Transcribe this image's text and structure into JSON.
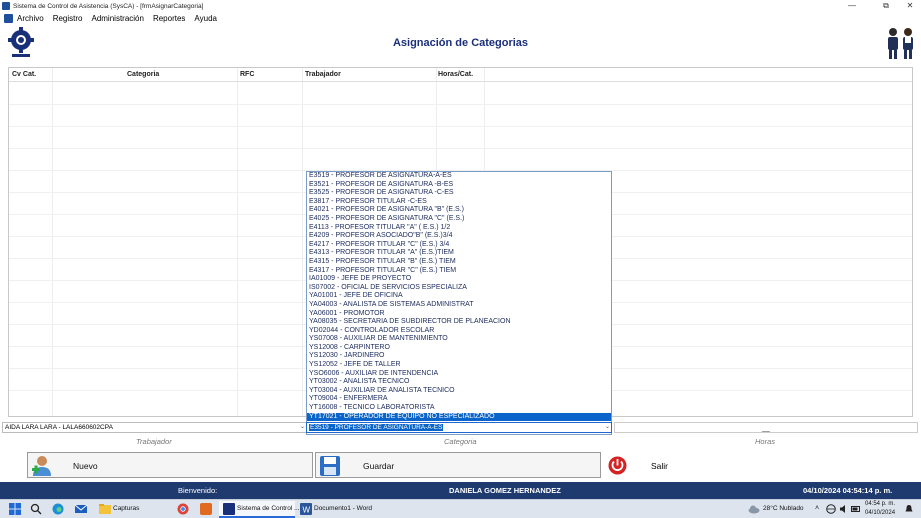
{
  "window": {
    "title": "Sistema de Control de Asistencia (SysCA) - [frmAsignarCategoria]",
    "controls": [
      "—",
      "⧉",
      "✕"
    ]
  },
  "menu": [
    "Archivo",
    "Registro",
    "Administración",
    "Reportes",
    "Ayuda"
  ],
  "page": {
    "title": "Asignación de Categorias"
  },
  "grid": {
    "columns": [
      "Cv Cat.",
      "Categoria",
      "RFC",
      "Trabajador",
      "Horas/Cat."
    ]
  },
  "listbox": {
    "items": [
      "E3519 - PROFESOR DE ASIGNATURA-A-ES",
      "E3521 - PROFESOR DE ASIGNATURA -B-ES",
      "E3525 - PROFESOR DE ASIGNATURA -C-ES",
      "E3817 - PROFESOR TITULAR -C-ES",
      "E4021 - PROFESOR DE ASIGNATURA \"B\" (E.S.)",
      "E4025 - PROFESOR DE ASIGNATURA \"C\" (E.S.)",
      "E4113 - PROFESOR TITULAR  \"A\" ( E.S.) 1/2",
      "E4209 - PROFESOR ASOCIADO\"B\" (E.S.)3/4",
      "E4217 - PROFESOR TITULAR \"C\" (E.S.) 3/4",
      "E4313 - PROFESOR TITULAR  \"A\" (E.S.)TIEM",
      "E4315 - PROFESOR TITULAR \"B\" (E.S.) TIEM",
      "E4317 - PROFESOR TITULAR \"C\" (E.S.) TIEM",
      "IA01009 - JEFE DE PROYECTO",
      "IS07002 - OFICIAL DE SERVICIOS ESPECIALIZA",
      "YA01001 - JEFE DE OFICINA",
      "YA04003 - ANALISTA DE SISTEMAS ADMINISTRAT",
      "YA06001 - PROMOTOR",
      "YA08035 - SECRETARIA DE SUBDIRECTOR DE PLANEACION",
      "YD02044 - CONTROLADOR ESCOLAR",
      "YS07008 - AUXILIAR DE MANTENIMIENTO",
      "YS12008 - CARPINTERO",
      "YS12030 - JARDINERO",
      "YS12052 - JEFE DE TALLER",
      "YSO6006 - AUXILIAR DE INTENDENCIA",
      "YT03002 - ANALISTA TECNICO",
      "YT03004 - AUXILIAR DE ANALISTA TECNICO",
      "YT09004 - ENFERMERA",
      "YT16008 - TECNICO LABORATORISTA",
      "YT17021 - OPERADOR DE EQUIPO NO ESPECIALIZADO"
    ],
    "selected_index": 28
  },
  "inputs": {
    "trabajador_value": "AIDA LARA LARA - LALA660602CPA",
    "categoria_value": "E3519 - PROFESOR DE ASIGNATURA-A-ES",
    "hours_value": "__"
  },
  "captions": {
    "trabajador": "Trabajador",
    "categoria": "Categoria",
    "horas": "Horas"
  },
  "buttons": {
    "nuevo": "Nuevo",
    "guardar": "Guardar",
    "salir": "Salir"
  },
  "status": {
    "welcome": "Bienvenido:",
    "user": "DANIELA GOMEZ HERNANDEZ",
    "datetime": "04/10/2024 04:54:14 p. m."
  },
  "taskbar": {
    "items": [
      "Capturas",
      "Sistema de Control ...",
      "Documento1 - Word"
    ],
    "weather": "28°C  Nublado",
    "time": "04:54 p. m.",
    "date": "04/10/2024"
  },
  "colors": {
    "accent": "#1e3a6e",
    "selection": "#0a64c9",
    "title": "#1a2f7a"
  }
}
